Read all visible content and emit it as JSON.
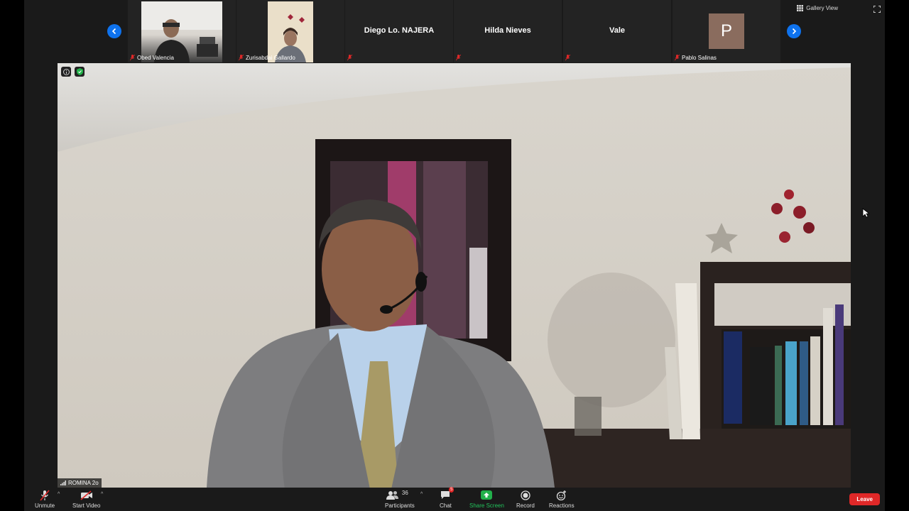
{
  "participants_strip": {
    "tiles": [
      {
        "name": "Obed Valencia"
      },
      {
        "name": "Zurisabdai Gallardo"
      },
      {
        "name": "Diego Lo. NAJERA"
      },
      {
        "name": "Hilda Nieves"
      },
      {
        "name": "Vale"
      },
      {
        "name": "Pablo Salinas",
        "avatar_letter": "P"
      }
    ]
  },
  "view_controls": {
    "gallery_label": "Gallery View"
  },
  "main_video": {
    "speaker_name": "ROMINA 2o"
  },
  "toolbar": {
    "unmute_label": "Unmute",
    "start_video_label": "Start Video",
    "participants_label": "Participants",
    "participants_count": "36",
    "chat_label": "Chat",
    "chat_badge": "5",
    "share_screen_label": "Share Screen",
    "record_label": "Record",
    "reactions_label": "Reactions",
    "leave_label": "Leave"
  },
  "colors": {
    "accent": "#0e72ed",
    "share": "#22b04b",
    "leave": "#e02828",
    "muted": "#e02828"
  }
}
